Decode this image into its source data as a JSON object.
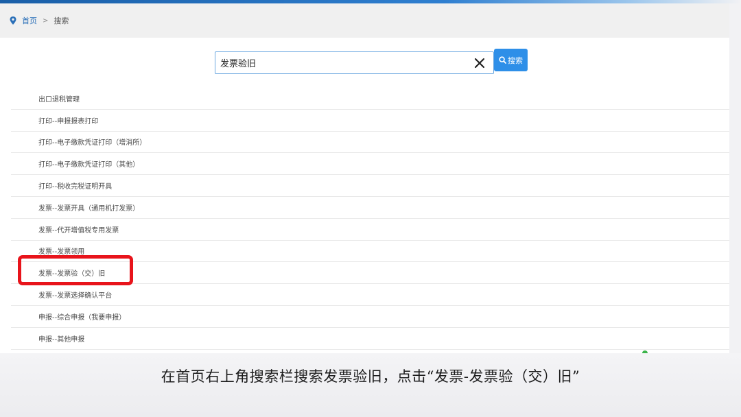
{
  "breadcrumb": {
    "home": "首页",
    "separator": ">",
    "current": "搜索"
  },
  "search": {
    "value": "发票验旧",
    "button_label": "搜索"
  },
  "results": [
    "出口退税管理",
    "打印--申报报表打印",
    "打印--电子缴款凭证打印（增消所）",
    "打印--电子缴款凭证打印（其他）",
    "打印--税收完税证明开具",
    "发票--发票开具（通用机打发票）",
    "发票--代开增值税专用发票",
    "发票--发票领用",
    "发票--发票验（交）旧",
    "发票--发票选择确认平台",
    "申报--综合申报（我要申报）",
    "申报--其他申报"
  ],
  "caption": "在首页右上角搜索栏搜索发票验旧，点击“发票-发票验（交）旧”",
  "colors": {
    "accent": "#2e8fe8",
    "highlight": "#e8141b"
  }
}
